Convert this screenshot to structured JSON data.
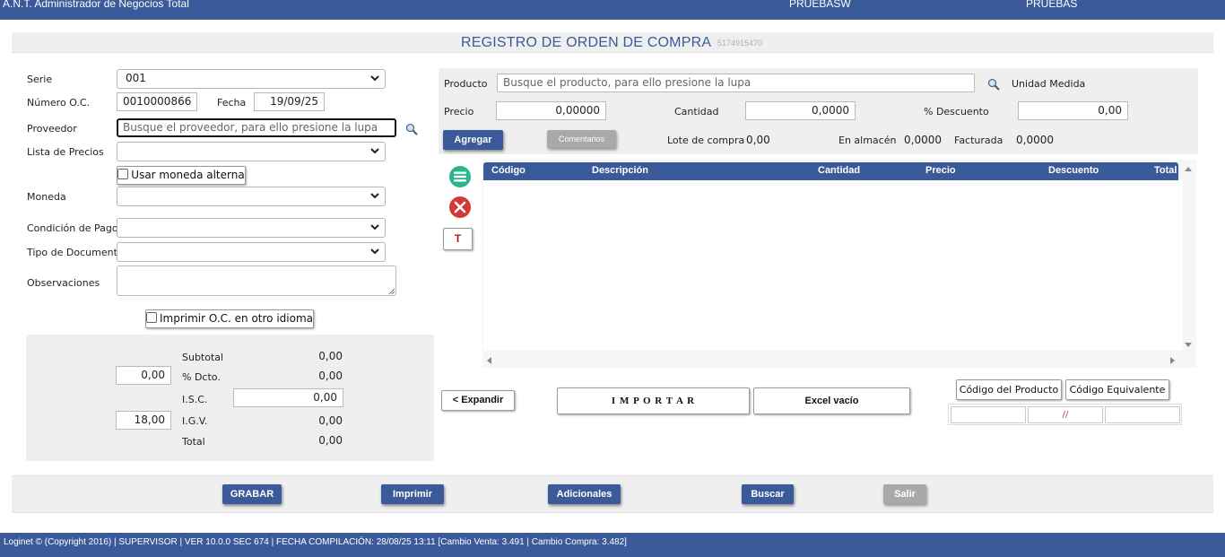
{
  "header": {
    "app_title": "A.N.T. Administrador de Negocios Total",
    "company": "PRUEBASW",
    "user": "PRUEBAS"
  },
  "page": {
    "title": "REGISTRO DE ORDEN DE COMPRA",
    "code": "5174915470"
  },
  "form": {
    "serie_label": "Serie",
    "serie_value": "001",
    "numero_label": "Número O.C.",
    "numero_value": "0010000866",
    "fecha_label": "Fecha",
    "fecha_value": "19/09/25",
    "proveedor_label": "Proveedor",
    "proveedor_placeholder": "Busque el proveedor, para ello presione la lupa",
    "lista_precios_label": "Lista de Precios",
    "lista_precios_value": "",
    "usar_moneda_label": "Usar moneda alterna",
    "moneda_label": "Moneda",
    "moneda_value": "",
    "condicion_label": "Condición de Pago",
    "condicion_value": "",
    "tipo_doc_label": "Tipo de Documento",
    "tipo_doc_value": "",
    "observaciones_label": "Observaciones",
    "observaciones_value": "",
    "imprimir_idioma_label": "Imprimir O.C. en otro idioma"
  },
  "totals": {
    "subtotal_label": "Subtotal",
    "subtotal_value": "0,00",
    "dcto_input": "0,00",
    "dcto_label": "% Dcto.",
    "dcto_value": "0,00",
    "isc_label": "I.S.C.",
    "isc_input": "0,00",
    "igv_input": "18,00",
    "igv_label": "I.G.V.",
    "igv_value": "0,00",
    "total_label": "Total",
    "total_value": "0,00"
  },
  "product": {
    "producto_label": "Producto",
    "producto_placeholder": "Busque el producto, para ello presione la lupa",
    "unidad_label": "Unidad Medida",
    "precio_label": "Precio",
    "precio_value": "0,00000",
    "cantidad_label": "Cantidad",
    "cantidad_value": "0,0000",
    "descuento_label": "% Descuento",
    "descuento_value": "0,00",
    "agregar_label": "Agregar",
    "comentarios_label": "Comentarios",
    "lote_label": "Lote de compra",
    "lote_value": "0,00",
    "almacen_label": "En almacén",
    "almacen_value": "0,0000",
    "facturada_label": "Facturada",
    "facturada_value": "0,0000"
  },
  "grid": {
    "columns": [
      "Código",
      "Descripción",
      "Cantidad",
      "Precio",
      "Descuento",
      "Total"
    ],
    "tool_t_label": "T"
  },
  "actions": {
    "expandir_label": "< Expandir",
    "importar_label": "I M P O R T A R",
    "excel_label": "Excel vacío",
    "codigo_producto_label": "Código del Producto",
    "codigo_equivalente_label": "Código Equivalente",
    "date_field_value": "//"
  },
  "footer": {
    "grabar_label": "GRABAR",
    "imprimir_label": "Imprimir",
    "adicionales_label": "Adicionales",
    "buscar_label": "Buscar",
    "salir_label": "Salir"
  },
  "statusbar": {
    "text": "Loginet © (Copyright 2016) | SUPERVISOR | VER 10.0.0 SEC 674 | FECHA COMPILACIÓN: 28/08/25 13:11 [Cambio Venta: 3.491 | Cambio Compra: 3.482]"
  },
  "colors": {
    "primary": "#3b5a9a",
    "panel": "#efefef",
    "list_icon": "#2bb58c",
    "delete_icon": "#d23a3a",
    "t_icon": "#b01818"
  },
  "icons": [
    "search-icon",
    "list-icon",
    "delete-icon",
    "chevron-down-icon",
    "scroll-up-icon",
    "scroll-down-icon",
    "scroll-left-icon",
    "scroll-right-icon"
  ]
}
